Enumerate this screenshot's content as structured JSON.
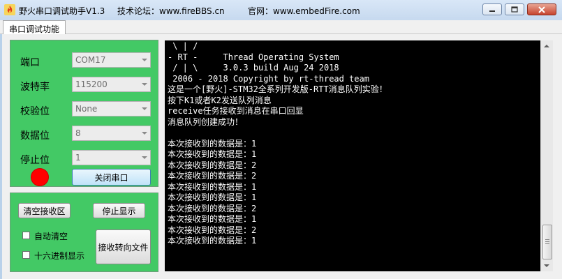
{
  "window": {
    "title": "野火串口调试助手V1.3",
    "forum": "技术论坛：www.fireBBS.cn",
    "site": "官网：www.embedFire.com",
    "icon": "fire-icon"
  },
  "tabs": [
    {
      "label": "串口调试功能",
      "active": true
    }
  ],
  "serial_settings": {
    "port": {
      "label": "端口",
      "value": "COM17"
    },
    "baud": {
      "label": "波特率",
      "value": "115200"
    },
    "parity": {
      "label": "校验位",
      "value": "None"
    },
    "databits": {
      "label": "数据位",
      "value": "8"
    },
    "stopbits": {
      "label": "停止位",
      "value": "1"
    },
    "status_led_color": "#ff0000",
    "toggle_button": "关闭串口"
  },
  "receive_controls": {
    "clear_button": "清空接收区",
    "stop_button": "停止显示",
    "auto_clear": {
      "label": "自动清空",
      "checked": false
    },
    "hex_display": {
      "label": "十六进制显示",
      "checked": false
    },
    "redirect_button": "接收转向文件"
  },
  "terminal": {
    "lines": [
      " \\ | /",
      "- RT -     Thread Operating System",
      " / | \\     3.0.3 build Aug 24 2018",
      " 2006 - 2018 Copyright by rt-thread team",
      "这是一个[野火]-STM32全系列开发版-RTT消息队列实验！",
      "按下K1或者K2发送队列消息",
      "receive任务接收到消息在串口回显",
      "消息队列创建成功！",
      "",
      "本次接收到的数据是：1",
      "本次接收到的数据是：1",
      "本次接收到的数据是：2",
      "本次接收到的数据是：2",
      "本次接收到的数据是：1",
      "本次接收到的数据是：1",
      "本次接收到的数据是：2",
      "本次接收到的数据是：1",
      "本次接收到的数据是：2",
      "本次接收到的数据是：1"
    ]
  },
  "colors": {
    "panel": "#43c965",
    "terminal_bg": "#000000",
    "terminal_fg": "#ffffff"
  }
}
